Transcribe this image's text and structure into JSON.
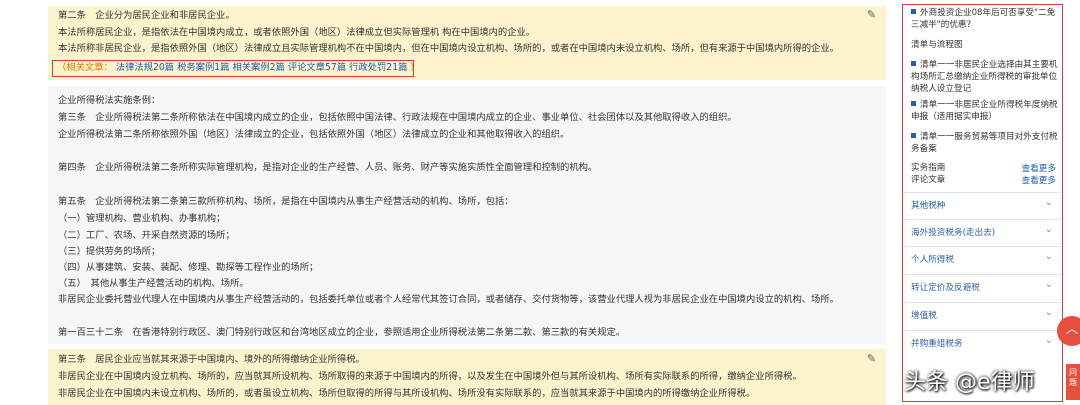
{
  "article1": {
    "lines": [
      "第二条　企业分为居民企业和非居民企业。",
      "本法所称居民企业，是指依法在中国境内成立，或者依照外国（地区）法律成立但实际管理机 构在中国境内的企业。",
      "本法所称非居民企业，是指依照外国（地区）法律成立且实际管理机构不在中国境内，但在中国境内设立机构、场所的，或者在中国境内未设立机构、场所，但有来源于中国境内所得的企业。"
    ],
    "refs": {
      "label": "（相关文章：",
      "links": [
        "法律法规20篇",
        "税务案例1篇",
        "相关案例2篇",
        "评论文章57篇",
        "行政处罚21篇"
      ],
      "end": "）"
    }
  },
  "explanation": {
    "lines": [
      "企业所得税法实施条例：",
      "第三条　企业所得税法第二条所称依法在中国境内成立的企业，包括依照中国法律、行政法规在中国境内成立的企业、事业单位、社会团体以及其他取得收入的组织。",
      "企业所得税法第二条所称依照外国（地区）法律成立的企业，包括依照外国（地区）法律成立的企业和其他取得收入的组织。",
      "第四条　企业所得税法第二条所称实际管理机构，是指对企业的生产经营、人员、账务、财产等实施实质性全面管理和控制的机构。",
      "第五条　企业所得税法第二条第三款所称机构、场所，是指在中国境内从事生产经营活动的机构、场所，包括：",
      "（一）管理机构、营业机构、办事机构；",
      "（二）工厂、农场、开采自然资源的场所；",
      "（三）提供劳务的场所；",
      "（四）从事建筑、安装、装配、修理、勘探等工程作业的场所；",
      "（五）　其他从事生产经营活动的机构、场所。",
      "非居民企业委托营业代理人在中国境内从事生产经营活动的，包括委托单位或者个人经常代其签订合同，或者储存、交付货物等，该营业代理人视为非居民企业在中国境内设立的机构、场所。",
      "第一百三十二条　在香港特别行政区、澳门特别行政区和台湾地区成立的企业，参照适用企业所得税法第二条第二款、第三款的有关规定。"
    ]
  },
  "article2": {
    "lines": [
      "第三条　居民企业应当就其来源于中国境内、境外的所得缴纳企业所得税。",
      "非居民企业在中国境内设立机构、场所的，应当就其所设机构、场所取得的来源于中国境内的所得，以及发生在中国境外但与其所设机构、场所有实际联系的所得，缴纳企业所得税。",
      "非居民企业在中国境内未设立机构、场所的，或者虽设立机构、场所但取得的所得与其所设机构、场所没有实际联系的，应当就其来源于中国境内的所得缴纳企业所得税。"
    ]
  },
  "sidebar": {
    "top_item": "外商投资企业08年后可否享受\"二免三减半\"的优惠？",
    "section_title": "清单与流程图",
    "items": [
      "清单一一非居民企业选择由其主要机构场所汇总缴纳企业所得税的审批单位纳税人设立登记",
      "清单一一非居民企业所得税年度纳税申报（适用据实申报）",
      "清单一一服务贸易等项目对外支付税务备案"
    ],
    "practice_label": "实务指南",
    "comment_label": "评论文章",
    "more_label": "查看更多",
    "categories": [
      "其他税种",
      "海外投资税务(走出去)",
      "个人所得税",
      "转让定价及反避税",
      "增值税",
      "并购重组税务"
    ]
  },
  "watermark": "头条 @e律师",
  "side_tab": "问题"
}
